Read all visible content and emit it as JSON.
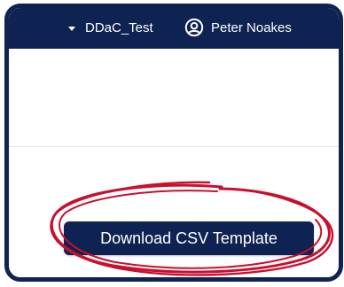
{
  "header": {
    "workspace_label": "DDaC_Test",
    "user_name": "Peter Noakes"
  },
  "actions": {
    "download_csv_label": "Download CSV Template"
  },
  "colors": {
    "brand_navy": "#0f2352",
    "annotation_red": "#c8102e"
  },
  "icons": {
    "workspace_dropdown": "caret-down-icon",
    "user": "user-circle-icon"
  }
}
